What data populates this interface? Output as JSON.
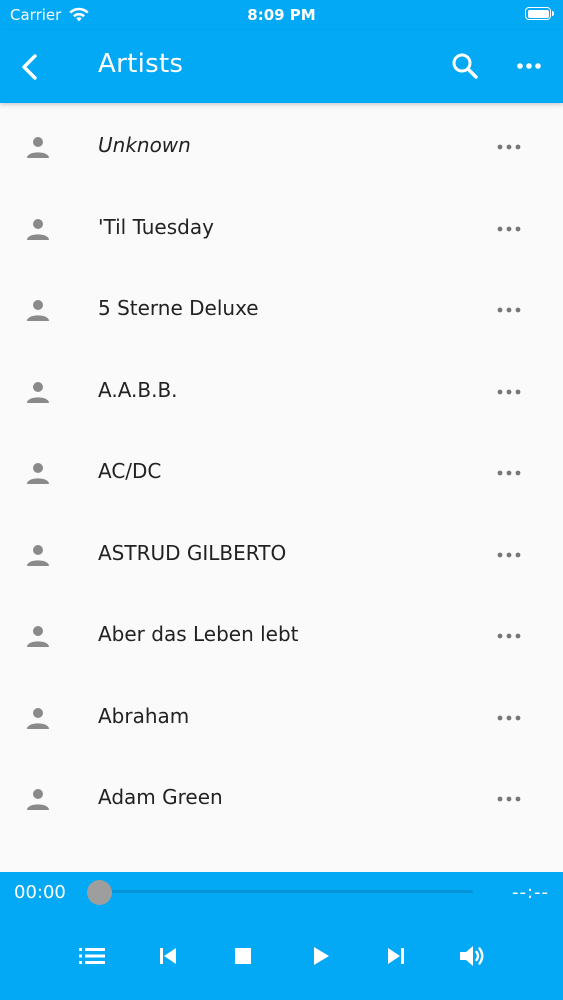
{
  "status_bar": {
    "carrier": "Carrier",
    "time": "8:09 PM"
  },
  "header": {
    "title": "Artists"
  },
  "artists": [
    {
      "name": "Unknown",
      "italic": true
    },
    {
      "name": "'Til Tuesday"
    },
    {
      "name": "5 Sterne Deluxe"
    },
    {
      "name": "A.A.B.B."
    },
    {
      "name": "AC/DC"
    },
    {
      "name": "ASTRUD GILBERTO"
    },
    {
      "name": "Aber das Leben lebt"
    },
    {
      "name": "Abraham"
    },
    {
      "name": "Adam Green"
    }
  ],
  "player": {
    "current_time": "00:00",
    "duration": "--:--",
    "progress": 0
  },
  "icons": {
    "back": "chevron-left-icon",
    "search": "search-icon",
    "more": "more-horizontal-icon",
    "artist": "person-icon",
    "row_menu": "more-horizontal-icon",
    "queue": "list-icon",
    "previous": "skip-previous-icon",
    "stop": "stop-icon",
    "play": "play-icon",
    "next": "skip-next-icon",
    "volume": "volume-icon"
  },
  "colors": {
    "accent": "#03a9f4",
    "background": "#fafafa",
    "text": "#222222",
    "icon_gray": "#8a8a8a"
  }
}
